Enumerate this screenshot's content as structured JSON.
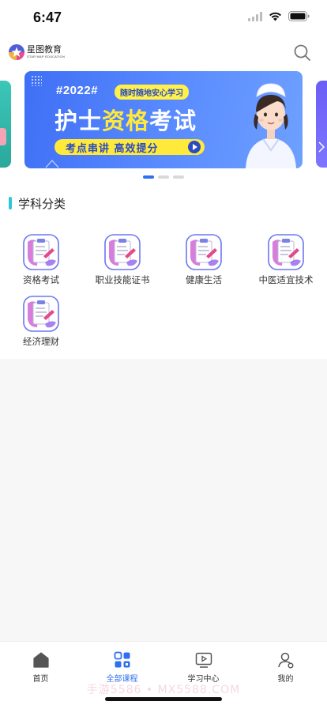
{
  "status": {
    "time": "6:47"
  },
  "header": {
    "brand_name": "星图教育",
    "brand_sub": "STAR MAP EDUCATION"
  },
  "banner": {
    "year_tag": "#2022#",
    "pill": "随时随地安心学习",
    "title_part1": "护士",
    "title_highlight": "资格",
    "title_part2": "考试",
    "cta": "考点串讲 高效提分",
    "active_slide": 1,
    "slide_count": 3
  },
  "section": {
    "title": "学科分类"
  },
  "categories": [
    {
      "label": "资格考试",
      "icon": "clipboard-icon"
    },
    {
      "label": "职业技能证书",
      "icon": "clipboard-icon"
    },
    {
      "label": "健康生活",
      "icon": "clipboard-icon"
    },
    {
      "label": "中医适宜技术",
      "icon": "clipboard-icon"
    },
    {
      "label": "经济理财",
      "icon": "clipboard-icon"
    }
  ],
  "tabs": [
    {
      "label": "首页",
      "icon": "home-icon",
      "active": false
    },
    {
      "label": "全部课程",
      "icon": "grid-icon",
      "active": true
    },
    {
      "label": "学习中心",
      "icon": "video-icon",
      "active": false
    },
    {
      "label": "我的",
      "icon": "user-icon",
      "active": false
    }
  ],
  "watermark": "手游5586 • MX5588.COM",
  "colors": {
    "accent": "#2f6ff0",
    "section_bar": "#2cc7d6",
    "banner": "#4a7cf7",
    "highlight": "#ffe93b"
  }
}
